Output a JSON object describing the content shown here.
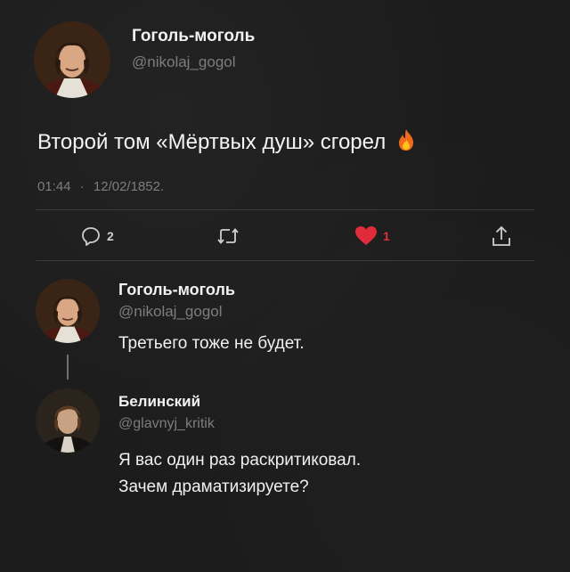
{
  "main_tweet": {
    "author": {
      "name": "Гоголь-моголь",
      "handle": "@nikolaj_gogol"
    },
    "text": "Второй том «Мёртвых душ» сгорел",
    "emoji": "🔥",
    "time": "01:44",
    "separator": "·",
    "date": "12/02/1852."
  },
  "actions": {
    "reply_count": "2",
    "like_count": "1",
    "icons": [
      "reply-icon",
      "retweet-icon",
      "heart-icon",
      "share-icon"
    ],
    "like_color": "#e02c3a"
  },
  "replies": [
    {
      "author": {
        "name": "Гоголь-моголь",
        "handle": "@nikolaj_gogol"
      },
      "text": "Третьего тоже не будет."
    },
    {
      "author": {
        "name": "Белинский",
        "handle": "@glavnyj_kritik"
      },
      "lines": [
        "Я вас один раз раскритиковал.",
        "Зачем драматизируете?"
      ]
    }
  ]
}
